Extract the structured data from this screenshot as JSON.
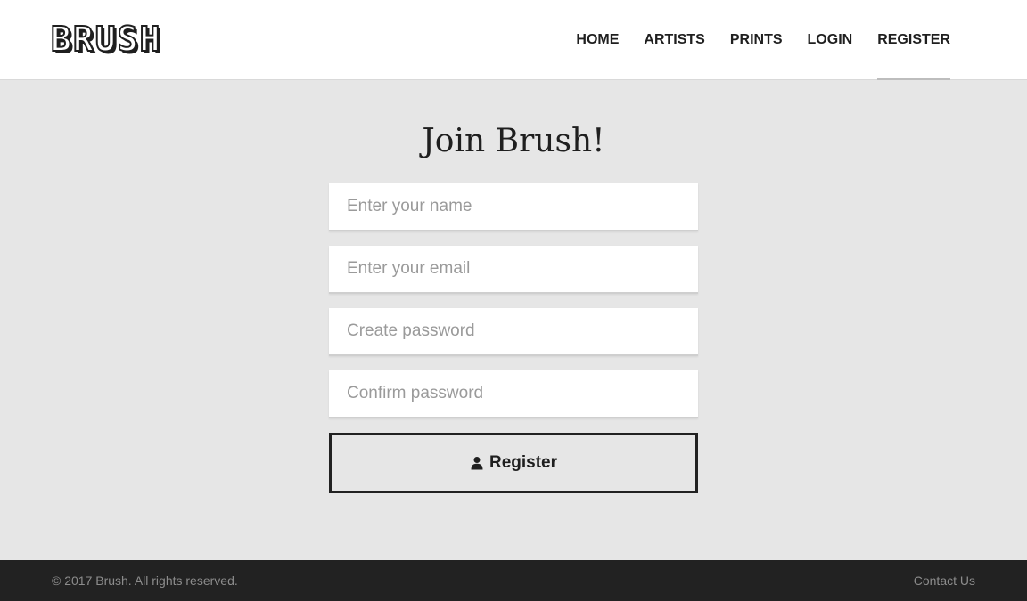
{
  "header": {
    "logo_text": "BRUSH",
    "nav": [
      {
        "label": "HOME"
      },
      {
        "label": "ARTISTS"
      },
      {
        "label": "PRINTS"
      },
      {
        "label": "LOGIN"
      },
      {
        "label": "REGISTER",
        "active": true
      }
    ]
  },
  "main": {
    "title": "Join Brush!",
    "form": {
      "name_placeholder": "Enter your name",
      "email_placeholder": "Enter your email",
      "password_placeholder": "Create password",
      "confirm_placeholder": "Confirm password",
      "register_label": "Register",
      "register_icon": "user-icon"
    }
  },
  "footer": {
    "copyright": "© 2017 Brush. All rights reserved.",
    "contact": "Contact Us"
  },
  "colors": {
    "header_bg": "#ffffff",
    "page_bg": "#e6e6e6",
    "footer_bg": "#222222",
    "text_dark": "#1f1f1f",
    "active_underline": "#bdbdbd"
  }
}
